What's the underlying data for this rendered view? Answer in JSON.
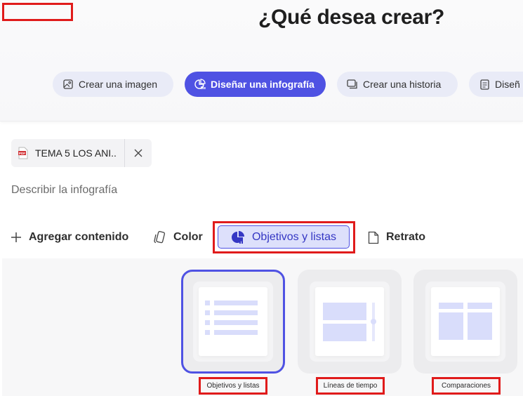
{
  "header": {
    "title": "¿Qué desea crear?"
  },
  "modes": [
    {
      "label": "Crear una imagen",
      "icon": "image-icon",
      "active": false
    },
    {
      "label": "Diseñar una infografía",
      "icon": "infographic-icon",
      "active": true
    },
    {
      "label": "Crear una historia",
      "icon": "story-icon",
      "active": false
    },
    {
      "label": "Diseñ",
      "icon": "document-icon",
      "active": false
    }
  ],
  "attachment": {
    "file_name": "TEMA 5 LOS ANI...",
    "file_type": "PDF"
  },
  "prompt": {
    "placeholder": "Describir la infografía"
  },
  "toolbar": {
    "add_content": "Agregar contenido",
    "color": "Color",
    "style": "Objetivos y listas",
    "orientation": "Retrato"
  },
  "templates": [
    {
      "label": "Objetivos y listas",
      "selected": true
    },
    {
      "label": "Líneas de tiempo",
      "selected": false
    },
    {
      "label": "Comparaciones",
      "selected": false
    }
  ],
  "colors": {
    "accent": "#4f52e3",
    "accent_light": "#dde0fb",
    "pill_bg": "#e9ebf7",
    "highlight_box": "#e01b1b",
    "template_shape": "#d9ddfb"
  }
}
